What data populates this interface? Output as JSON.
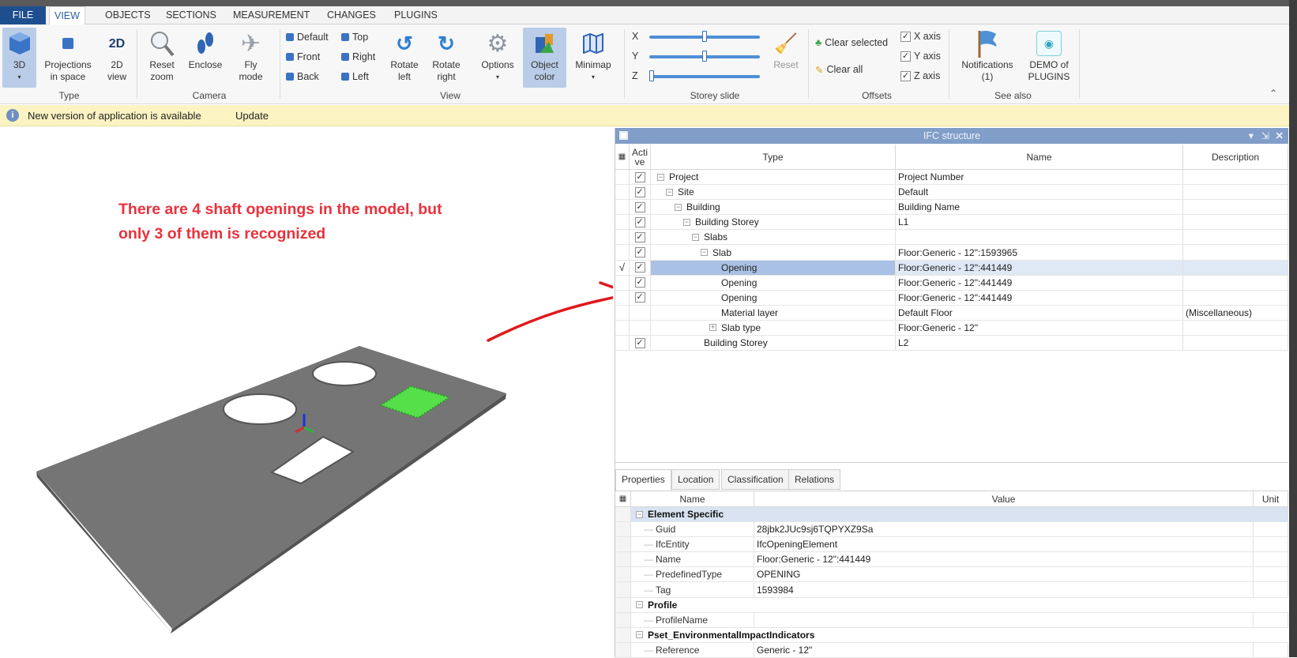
{
  "menu_tabs": [
    "FILE",
    "VIEW",
    "OBJECTS",
    "SECTIONS",
    "MEASUREMENT",
    "CHANGES",
    "PLUGINS"
  ],
  "ribbon": {
    "type": {
      "label": "Type",
      "b3d": "3D",
      "projections": "Projections\nin space",
      "view2d": "2D\nview",
      "icon2d": "2D"
    },
    "camera": {
      "label": "Camera",
      "reset_zoom": "Reset\nzoom",
      "enclose": "Enclose",
      "fly_mode": "Fly\nmode"
    },
    "view": {
      "label": "View",
      "default": "Default",
      "front": "Front",
      "back": "Back",
      "top": "Top",
      "right": "Right",
      "left": "Left",
      "rotate_left": "Rotate\nleft",
      "rotate_right": "Rotate\nright",
      "options": "Options",
      "object_color": "Object\ncolor",
      "minimap": "Minimap"
    },
    "storey": {
      "label": "Storey slide",
      "x": "X",
      "y": "Y",
      "z": "Z",
      "reset": "Reset",
      "x_value": 0.5,
      "y_value": 0.5,
      "z_value": 0.0
    },
    "offsets": {
      "label": "Offsets",
      "clear_selected": "Clear selected",
      "clear_all": "Clear all",
      "x_axis": "X axis",
      "y_axis": "Y axis",
      "z_axis": "Z axis"
    },
    "see_also": {
      "label": "See also",
      "notifications": "Notifications\n(1)",
      "demo": "DEMO of\nPLUGINS"
    }
  },
  "notification": {
    "text": "New version of application is available",
    "action": "Update"
  },
  "annotation": {
    "line1": "There are 4 shaft openings in the model, but",
    "line2": "only 3 of them is recognized"
  },
  "ifc": {
    "title": "IFC structure",
    "headers": {
      "active": "Acti\nve",
      "type": "Type",
      "name": "Name",
      "description": "Description"
    },
    "rows": [
      {
        "level": 0,
        "exp": "-",
        "active": true,
        "type": "Project",
        "name": "Project Number",
        "desc": ""
      },
      {
        "level": 1,
        "exp": "-",
        "active": true,
        "type": "Site",
        "name": "Default",
        "desc": ""
      },
      {
        "level": 2,
        "exp": "-",
        "active": true,
        "type": "Building",
        "name": "Building Name",
        "desc": ""
      },
      {
        "level": 3,
        "exp": "-",
        "active": true,
        "type": "Building Storey",
        "name": "L1",
        "desc": ""
      },
      {
        "level": 4,
        "exp": "-",
        "active": true,
        "type": "Slabs",
        "name": "",
        "desc": ""
      },
      {
        "level": 5,
        "exp": "-",
        "active": true,
        "type": "Slab",
        "name": "Floor:Generic - 12\":1593965",
        "desc": ""
      },
      {
        "level": 6,
        "exp": "",
        "active": true,
        "type": "Opening",
        "name": "Floor:Generic - 12\":441449",
        "desc": "",
        "selected": true,
        "indicator": "√"
      },
      {
        "level": 6,
        "exp": "",
        "active": true,
        "type": "Opening",
        "name": "Floor:Generic - 12\":441449",
        "desc": ""
      },
      {
        "level": 6,
        "exp": "",
        "active": true,
        "type": "Opening",
        "name": "Floor:Generic - 12\":441449",
        "desc": ""
      },
      {
        "level": 6,
        "exp": "",
        "active": null,
        "type": "Material layer",
        "name": "Default Floor",
        "desc": "(Miscellaneous)"
      },
      {
        "level": 6,
        "exp": "+",
        "active": null,
        "type": "Slab type",
        "name": "Floor:Generic - 12\"",
        "desc": ""
      },
      {
        "level": 4,
        "exp": "",
        "active": true,
        "type": "Building Storey",
        "name": "L2",
        "desc": ""
      }
    ]
  },
  "properties": {
    "tabs": [
      "Properties",
      "Location",
      "Classification",
      "Relations"
    ],
    "headers": {
      "name": "Name",
      "value": "Value",
      "unit": "Unit"
    },
    "rows": [
      {
        "group": true,
        "name": "Element Specific",
        "hl": true
      },
      {
        "name": "Guid",
        "value": "28jbk2JUc9sj6TQPYXZ9Sa"
      },
      {
        "name": "IfcEntity",
        "value": "IfcOpeningElement"
      },
      {
        "name": "Name",
        "value": "Floor:Generic - 12\":441449"
      },
      {
        "name": "PredefinedType",
        "value": "OPENING"
      },
      {
        "name": "Tag",
        "value": "1593984"
      },
      {
        "group": true,
        "name": "Profile"
      },
      {
        "name": "ProfileName",
        "value": ""
      },
      {
        "group": true,
        "name": "Pset_EnvironmentalImpactIndicators"
      },
      {
        "name": "Reference",
        "value": "Generic - 12\""
      }
    ]
  },
  "colors": {
    "accent": "#1d4f8f",
    "title_bar": "#809ec8",
    "annotation": "#e8323c",
    "highlight_green": "#55e04a"
  }
}
